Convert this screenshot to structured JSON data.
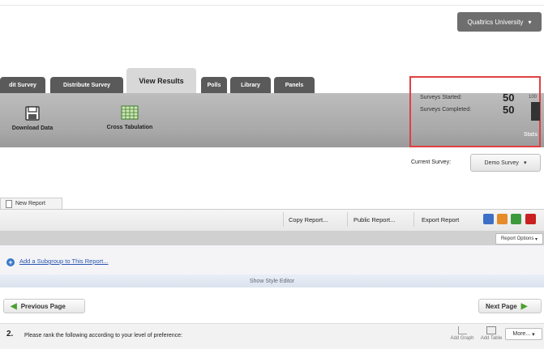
{
  "header": {
    "account_label": "Qualtrics University"
  },
  "tabs": [
    {
      "label": "dit Survey"
    },
    {
      "label": "Distribute Survey"
    },
    {
      "label": "View Results"
    },
    {
      "label": "Polls"
    },
    {
      "label": "Library"
    },
    {
      "label": "Panels"
    }
  ],
  "toolbar": {
    "download_label": "Download Data",
    "crosstab_label": "Cross Tabulation"
  },
  "stats": {
    "started_label": "Surveys Started:",
    "started_value": "50",
    "completed_label": "Surveys Completed:",
    "completed_value": "50",
    "corner_text": "100",
    "link_label": "Stats"
  },
  "current_survey": {
    "label": "Current Survey:",
    "value": "Demo Survey"
  },
  "report": {
    "tab_label": "New Report",
    "copy_label": "Copy Report...",
    "public_label": "Public Report...",
    "export_label": "Export Report",
    "options_label": "Report Options"
  },
  "subgroup": {
    "link_label": "Add a Subgroup to This Report..."
  },
  "style_editor": {
    "label": "Show Style Editor"
  },
  "paging": {
    "prev_label": "Previous Page",
    "next_label": "Next Page"
  },
  "question": {
    "number": "2.",
    "text": "Please rank the following according to your level of preference:",
    "add_graph": "Add Graph",
    "add_table": "Add Table",
    "more_label": "More..."
  },
  "colors": {
    "accent_red": "#e04040",
    "link_blue": "#2a55b0",
    "arrow_green": "#4aa02c"
  }
}
